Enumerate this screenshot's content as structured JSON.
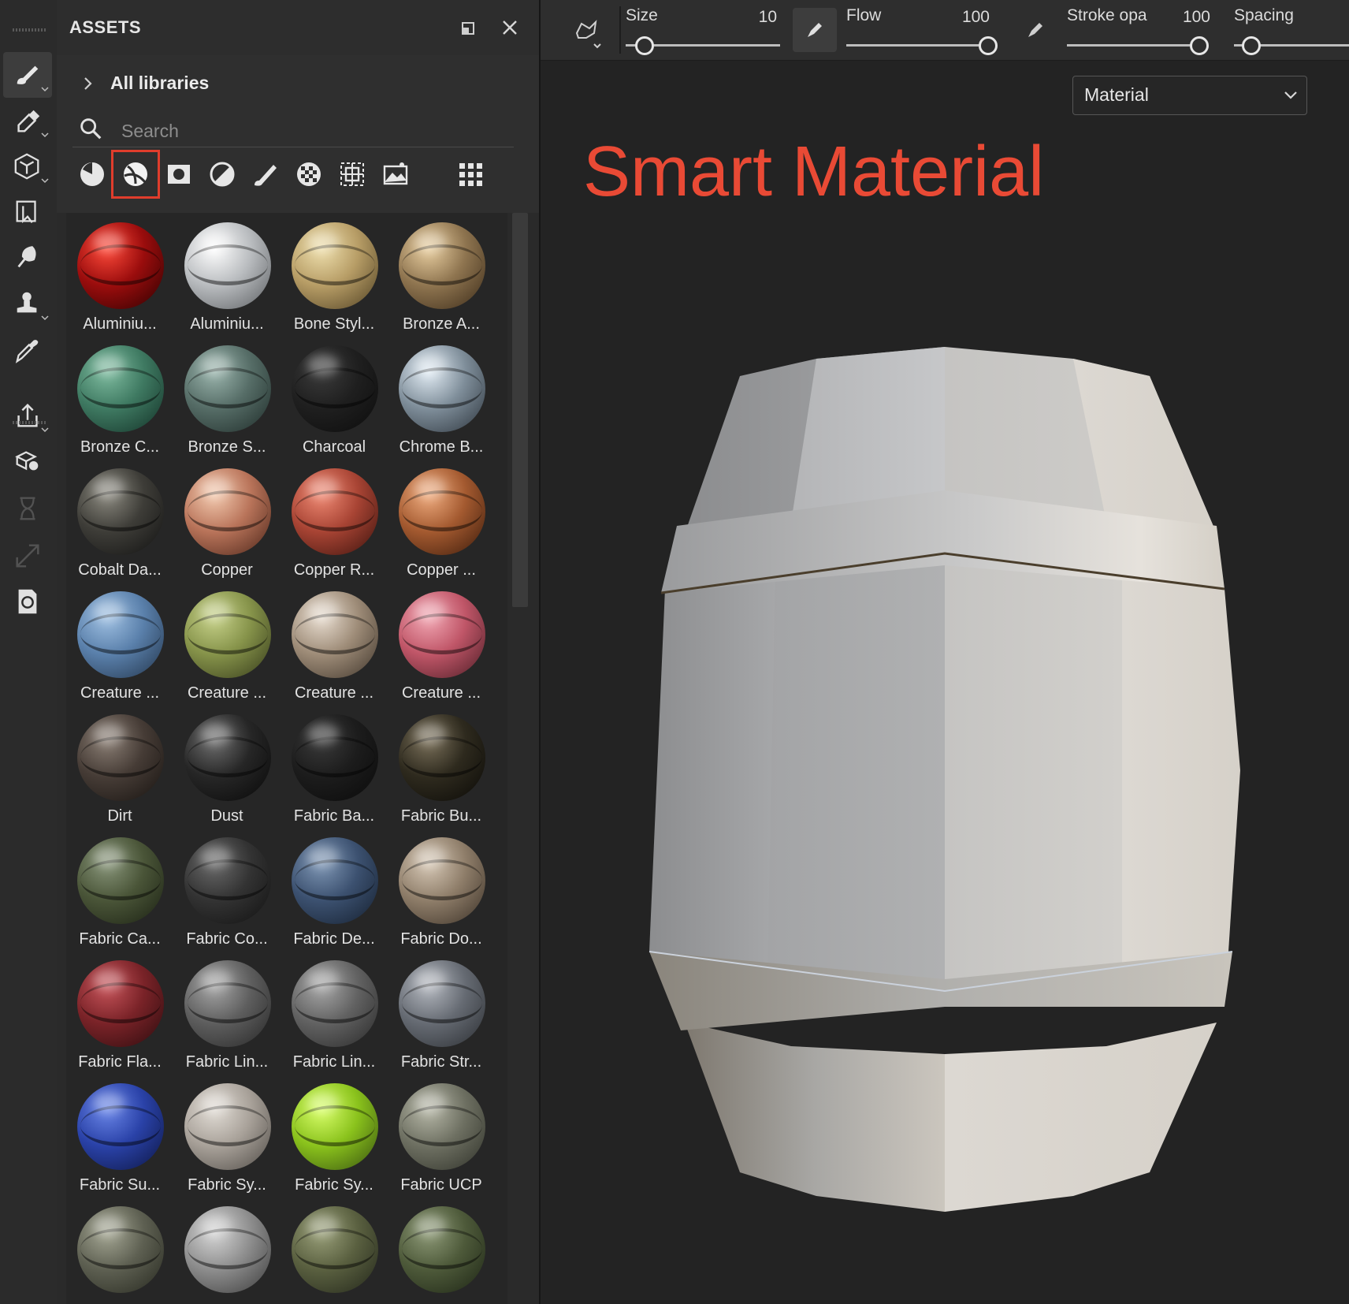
{
  "toolRail": {
    "tools": [
      {
        "icon": "paint-brush-icon",
        "active": true,
        "hasMenu": true
      },
      {
        "icon": "eraser-icon",
        "active": false,
        "hasMenu": true
      },
      {
        "icon": "projection-cube-icon",
        "active": false,
        "hasMenu": true
      },
      {
        "icon": "polygon-fill-icon",
        "active": false,
        "hasMenu": false
      },
      {
        "icon": "smudge-icon",
        "active": false,
        "hasMenu": false
      },
      {
        "icon": "clone-stamp-icon",
        "active": false,
        "hasMenu": true
      },
      {
        "icon": "color-picker-icon",
        "active": false,
        "hasMenu": false
      },
      {
        "icon": "export-icon",
        "active": false,
        "hasMenu": true
      },
      {
        "icon": "bake-icon",
        "active": false,
        "hasMenu": false
      },
      {
        "icon": "timer-icon",
        "active": false,
        "hasMenu": false
      },
      {
        "icon": "resize-icon",
        "active": false,
        "hasMenu": false
      },
      {
        "icon": "refresh-document-icon",
        "active": false,
        "hasMenu": false
      }
    ]
  },
  "assets": {
    "title": "ASSETS",
    "library": "All libraries",
    "searchPlaceholder": "Search",
    "filters": [
      {
        "icon": "material-filter-icon"
      },
      {
        "icon": "smart-material-filter-icon",
        "selected": true
      },
      {
        "icon": "mask-filter-icon"
      },
      {
        "icon": "filter-effect-icon"
      },
      {
        "icon": "brush-filter-icon"
      },
      {
        "icon": "alpha-filter-icon"
      },
      {
        "icon": "texture-filter-icon"
      },
      {
        "icon": "environment-filter-icon"
      }
    ],
    "items": [
      {
        "label": "Aluminiu...",
        "colors": [
          "#ff4a3a",
          "#9b0d0d",
          "#2a0000"
        ]
      },
      {
        "label": "Aluminiu...",
        "colors": [
          "#ffffff",
          "#b9bcbf",
          "#5a5d60"
        ]
      },
      {
        "label": "Bone Styl...",
        "colors": [
          "#efe0ae",
          "#b79d66",
          "#4e3f22"
        ]
      },
      {
        "label": "Bronze A...",
        "colors": [
          "#e9cfa1",
          "#8f7550",
          "#3a2a18"
        ]
      },
      {
        "label": "Bronze C...",
        "colors": [
          "#7fbca0",
          "#3f7a62",
          "#123026"
        ]
      },
      {
        "label": "Bronze S...",
        "colors": [
          "#9cb6ae",
          "#566d67",
          "#1e2b28"
        ]
      },
      {
        "label": "Charcoal",
        "colors": [
          "#3b3b3b",
          "#1f1f1f",
          "#0c0c0c"
        ]
      },
      {
        "label": "Chrome B...",
        "colors": [
          "#e3edf5",
          "#7f8e9a",
          "#2b333b"
        ]
      },
      {
        "label": "Cobalt Da...",
        "colors": [
          "#8c8a80",
          "#3e3d38",
          "#111111"
        ]
      },
      {
        "label": "Copper",
        "colors": [
          "#f4cbb0",
          "#b9745a",
          "#4a2418"
        ]
      },
      {
        "label": "Copper R...",
        "colors": [
          "#f08a74",
          "#a84434",
          "#3a120c"
        ]
      },
      {
        "label": "Copper ...",
        "colors": [
          "#f0ad80",
          "#a45a30",
          "#3a1a0a"
        ]
      },
      {
        "label": "Creature ...",
        "colors": [
          "#9fc0e2",
          "#5a80ab",
          "#22344a"
        ]
      },
      {
        "label": "Creature ...",
        "colors": [
          "#c7d28a",
          "#86934a",
          "#34391a"
        ]
      },
      {
        "label": "Creature ...",
        "colors": [
          "#e8ddd0",
          "#9e8c78",
          "#3e342a"
        ]
      },
      {
        "label": "Creature ...",
        "colors": [
          "#f2a8b4",
          "#c05668",
          "#4a1c24"
        ]
      },
      {
        "label": "Dirt",
        "colors": [
          "#8a7e74",
          "#463c36",
          "#171310"
        ]
      },
      {
        "label": "Dust",
        "colors": [
          "#6e6e6e",
          "#262626",
          "#080808"
        ]
      },
      {
        "label": "Fabric Ba...",
        "colors": [
          "#3a3a3a",
          "#1c1c1c",
          "#0a0a0a"
        ]
      },
      {
        "label": "Fabric Bu...",
        "colors": [
          "#7a705a",
          "#2e2a1e",
          "#0a0906"
        ]
      },
      {
        "label": "Fabric Ca...",
        "colors": [
          "#88957a",
          "#4a5538",
          "#1a2012"
        ]
      },
      {
        "label": "Fabric Co...",
        "colors": [
          "#6a6a6a",
          "#333333",
          "#111111"
        ]
      },
      {
        "label": "Fabric De...",
        "colors": [
          "#7f97b5",
          "#3c5170",
          "#141f2e"
        ]
      },
      {
        "label": "Fabric Do...",
        "colors": [
          "#d6c8b6",
          "#8f7e6a",
          "#3a3026"
        ]
      },
      {
        "label": "Fabric Fla...",
        "colors": [
          "#c7545a",
          "#7a2328",
          "#2a0b0d"
        ]
      },
      {
        "label": "Fabric Lin...",
        "colors": [
          "#a6a6a6",
          "#5e5e5e",
          "#262626"
        ]
      },
      {
        "label": "Fabric Lin...",
        "colors": [
          "#a8a8a8",
          "#626262",
          "#282828"
        ]
      },
      {
        "label": "Fabric Str...",
        "colors": [
          "#b4b8bf",
          "#666b73",
          "#2a2d31"
        ]
      },
      {
        "label": "Fabric Su...",
        "colors": [
          "#6a86e8",
          "#2a42a8",
          "#0c1540"
        ]
      },
      {
        "label": "Fabric Sy...",
        "colors": [
          "#e2ddd6",
          "#a8a199",
          "#4e4a45"
        ]
      },
      {
        "label": "Fabric Sy...",
        "colors": [
          "#d9ff6a",
          "#8ac21c",
          "#365010"
        ]
      },
      {
        "label": "Fabric UCP",
        "colors": [
          "#b7b8a8",
          "#6e7062",
          "#2e3028"
        ]
      },
      {
        "label": "",
        "colors": [
          "#a6a895",
          "#5e6052",
          "#26281f"
        ]
      },
      {
        "label": "",
        "colors": [
          "#d6d6d6",
          "#8e8e8e",
          "#3a3a3a"
        ]
      },
      {
        "label": "",
        "colors": [
          "#9aa07a",
          "#5a6040",
          "#22261a"
        ]
      },
      {
        "label": "",
        "colors": [
          "#8e9a78",
          "#4e5a3a",
          "#1c2414"
        ]
      }
    ]
  },
  "toolbar": {
    "size_label": "Size",
    "size_value": "10",
    "size_fraction": 0.12,
    "flow_label": "Flow",
    "flow_value": "100",
    "flow_fraction": 1.0,
    "stroke_label": "Stroke opa",
    "stroke_value": "100",
    "stroke_fraction": 1.0,
    "spacing_label": "Spacing"
  },
  "viewport": {
    "mode": "Material",
    "heading": "Smart Material",
    "accent": "#e94a35"
  }
}
